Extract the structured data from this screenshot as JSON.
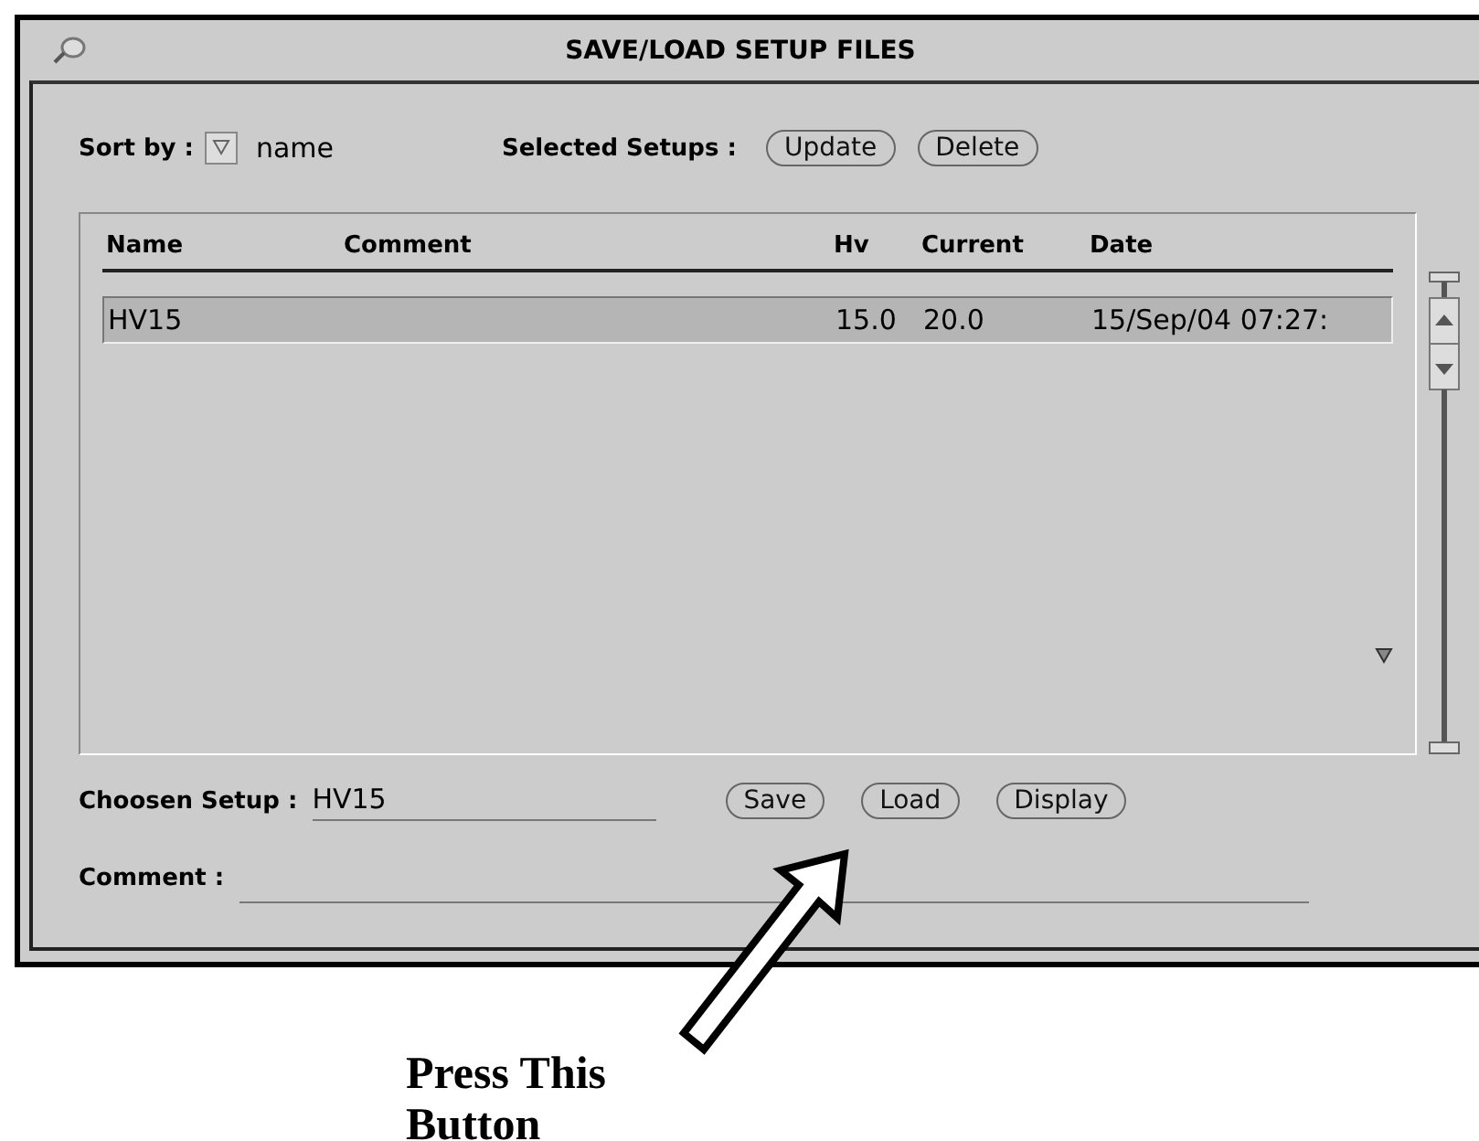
{
  "window": {
    "title": "SAVE/LOAD SETUP FILES"
  },
  "sort": {
    "label": "Sort by :",
    "value": "name"
  },
  "selected_setups": {
    "label": "Selected Setups :",
    "buttons": [
      "Update",
      "Delete"
    ]
  },
  "table": {
    "columns": [
      "Name",
      "Comment",
      "Hv",
      "Current",
      "Date"
    ],
    "rows": [
      {
        "name": "HV15",
        "hv": "15.0",
        "current": "20.0",
        "date": "15/Sep/04 07:27:",
        "selected": true
      }
    ]
  },
  "chosen_setup": {
    "label": "Choosen Setup :",
    "value": "HV15"
  },
  "action_buttons": [
    "Save",
    "Load",
    "Display"
  ],
  "comment": {
    "label": "Comment :"
  },
  "annotation": {
    "text": "Press This Button"
  }
}
